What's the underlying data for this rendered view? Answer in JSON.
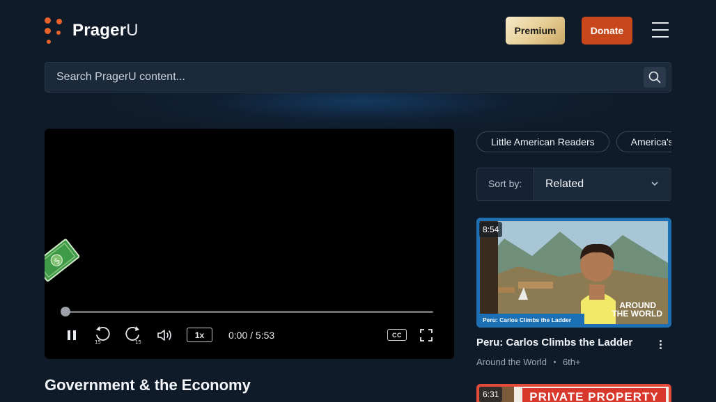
{
  "header": {
    "logo": {
      "text_bold": "Prager",
      "text_light": "U",
      "icon": "prageru-dots-logo"
    },
    "premium_label": "Premium",
    "donate_label": "Donate",
    "menu_icon": "hamburger-menu-icon"
  },
  "search": {
    "placeholder": "Search PragerU content...",
    "value": "",
    "icon": "search-icon"
  },
  "player": {
    "time": "0:00 / 5:53",
    "progress": 0,
    "speed_label": "1x",
    "cc_label": "CC",
    "rewind_label": "15",
    "forward_label": "15",
    "state": "playing"
  },
  "video": {
    "title": "Government & the Economy"
  },
  "sidebar": {
    "chips": [
      {
        "label": "Little American Readers"
      },
      {
        "label": "America's"
      }
    ],
    "sort": {
      "label": "Sort by:",
      "value": "Related"
    },
    "cards": [
      {
        "duration": "8:54",
        "title": "Peru: Carlos Climbs the Ladder",
        "series": "Around the World",
        "grade": "6th+",
        "thumb_caption": "Peru: Carlos Climbs the Ladder",
        "thumb_badge_line1": "AROUND",
        "thumb_badge_line2": "THE WORLD"
      },
      {
        "duration": "6:31",
        "thumb_banner": "PRIVATE PROPERTY"
      }
    ]
  },
  "colors": {
    "background": "#0f1b29",
    "donate": "#c8471b",
    "premium_gold": "#e5cc93",
    "logo_orange": "#e8622a"
  }
}
